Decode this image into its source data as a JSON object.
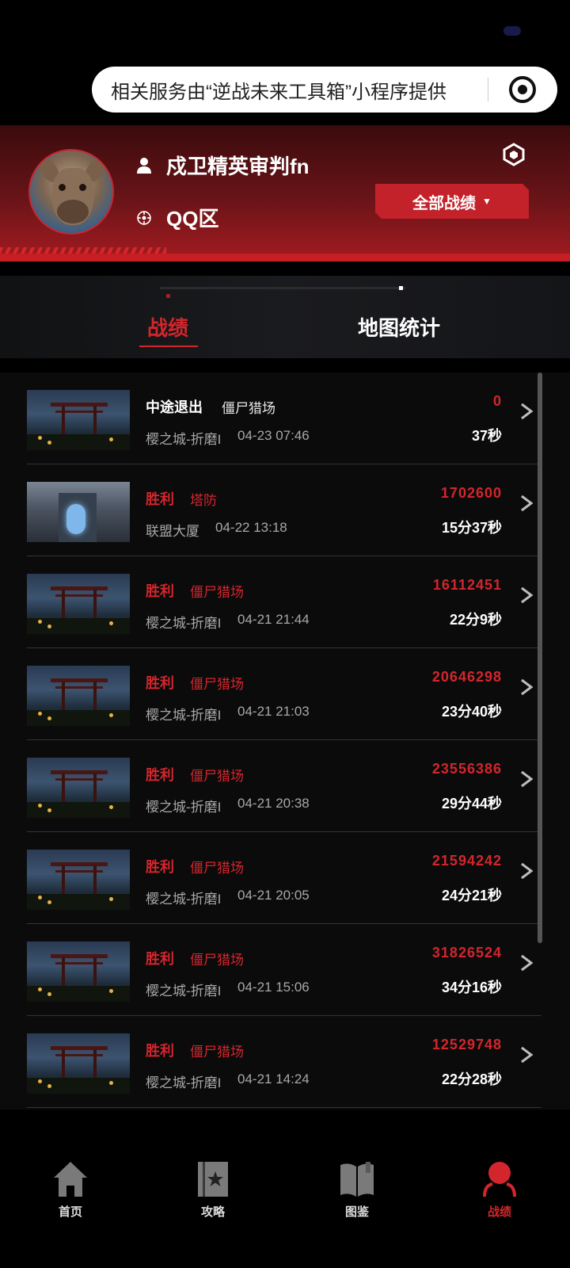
{
  "notice": {
    "text": "相关服务由“逆战未来工具箱”小程序提供"
  },
  "profile": {
    "name": "戍卫精英审判fn",
    "zone": "QQ区",
    "all_button": "全部战绩",
    "all_button_arrow": "▼"
  },
  "tabs": [
    {
      "label": "战绩",
      "active": true
    },
    {
      "label": "地图统计",
      "active": false
    }
  ],
  "records": [
    {
      "result": "中途退出",
      "mode": "僵尸猎场",
      "map": "樱之城-折磨I",
      "date": "04-23 07:46",
      "score": "0",
      "time": "37秒",
      "thumb": "torii"
    },
    {
      "result": "胜利",
      "mode": "塔防",
      "map": "联盟大厦",
      "date": "04-22 13:18",
      "score": "1702600",
      "time": "15分37秒",
      "thumb": "tower"
    },
    {
      "result": "胜利",
      "mode": "僵尸猎场",
      "map": "樱之城-折磨I",
      "date": "04-21 21:44",
      "score": "16112451",
      "time": "22分9秒",
      "thumb": "torii"
    },
    {
      "result": "胜利",
      "mode": "僵尸猎场",
      "map": "樱之城-折磨I",
      "date": "04-21 21:03",
      "score": "20646298",
      "time": "23分40秒",
      "thumb": "torii"
    },
    {
      "result": "胜利",
      "mode": "僵尸猎场",
      "map": "樱之城-折磨I",
      "date": "04-21 20:38",
      "score": "23556386",
      "time": "29分44秒",
      "thumb": "torii"
    },
    {
      "result": "胜利",
      "mode": "僵尸猎场",
      "map": "樱之城-折磨I",
      "date": "04-21 20:05",
      "score": "21594242",
      "time": "24分21秒",
      "thumb": "torii"
    },
    {
      "result": "胜利",
      "mode": "僵尸猎场",
      "map": "樱之城-折磨I",
      "date": "04-21 15:06",
      "score": "31826524",
      "time": "34分16秒",
      "thumb": "torii"
    },
    {
      "result": "胜利",
      "mode": "僵尸猎场",
      "map": "樱之城-折磨I",
      "date": "04-21 14:24",
      "score": "12529748",
      "time": "22分28秒",
      "thumb": "torii"
    }
  ],
  "nav": [
    {
      "label": "首页",
      "icon": "home-icon",
      "active": false
    },
    {
      "label": "攻略",
      "icon": "guide-book-icon",
      "active": false
    },
    {
      "label": "图鉴",
      "icon": "open-book-icon",
      "active": false
    },
    {
      "label": "战绩",
      "icon": "user-icon",
      "active": true
    }
  ],
  "colors": {
    "accent": "#d3262c",
    "header": "#6a1418",
    "background": "#0b0b0c"
  }
}
